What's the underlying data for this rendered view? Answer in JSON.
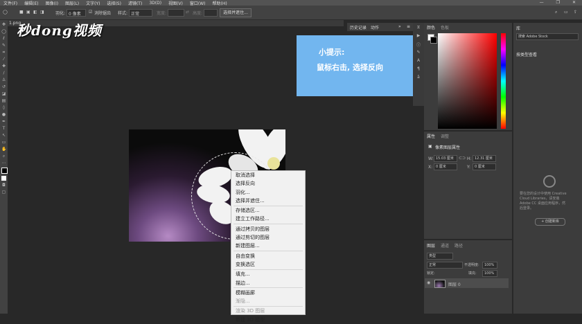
{
  "menubar": {
    "items": [
      "文件(F)",
      "编辑(E)",
      "图像(I)",
      "图层(L)",
      "文字(Y)",
      "选择(S)",
      "滤镜(T)",
      "3D(D)",
      "视图(V)",
      "窗口(W)",
      "帮助(H)"
    ],
    "window_controls": [
      "—",
      "❐",
      "✕"
    ]
  },
  "options": {
    "feather_label": "羽化:",
    "feather_value": "0 像素",
    "antialias_label": "消除锯齿",
    "style_label": "样式:",
    "style_value": "正常",
    "width_label": "宽度:",
    "height_label": "高度:",
    "select_mask_button": "选择并遮住..."
  },
  "document": {
    "tab_title": "1.png",
    "watermark": "秒dong视频"
  },
  "tip": {
    "title": "小提示:",
    "body": "鼠标右击, 选择反向"
  },
  "context_menu": {
    "items": [
      {
        "label": "取消选择",
        "disabled": false
      },
      {
        "label": "选择反向",
        "disabled": false
      },
      {
        "label": "羽化...",
        "disabled": false
      },
      {
        "label": "选择并遮住...",
        "disabled": false
      },
      {
        "sep": true
      },
      {
        "label": "存储选区...",
        "disabled": false
      },
      {
        "label": "建立工作路径...",
        "disabled": false
      },
      {
        "sep": true
      },
      {
        "label": "通过拷贝的图层",
        "disabled": false
      },
      {
        "label": "通过剪切的图层",
        "disabled": false
      },
      {
        "label": "新建图层...",
        "disabled": false
      },
      {
        "sep": true
      },
      {
        "label": "自由变换",
        "disabled": false
      },
      {
        "label": "变换选区",
        "disabled": false
      },
      {
        "sep": true
      },
      {
        "label": "填充...",
        "disabled": false
      },
      {
        "label": "描边...",
        "disabled": false
      },
      {
        "sep": true
      },
      {
        "label": "模糊画廊",
        "disabled": false
      },
      {
        "label": "渐隐...",
        "disabled": true
      },
      {
        "sep": true
      },
      {
        "label": "渲染 3D 图层",
        "disabled": true
      },
      {
        "label": "新建 3D 模型",
        "disabled": false
      }
    ]
  },
  "panels": {
    "history_tab": "历史记录",
    "actions_tab": "动作",
    "color_tab": "颜色",
    "swatches_tab": "色板",
    "properties_tab": "属性",
    "adjustments_tab": "调整",
    "doc_props": "像素图层属性",
    "w_label": "W:",
    "w_value": "15.03 厘米",
    "h_label": "H:",
    "h_value": "12.31 厘米",
    "x_label": "X:",
    "x_value": "0 厘米",
    "y_label": "Y:",
    "y_value": "0 厘米",
    "layers_tab": "图层",
    "channels_tab": "通道",
    "paths_tab": "路径",
    "kind_value": "类型",
    "blend_value": "正常",
    "opacity_label": "不透明度:",
    "opacity_value": "100%",
    "lock_label": "锁定:",
    "fill_label": "填充:",
    "fill_value": "100%",
    "layer_name": "图层 0",
    "libraries_tab": "库",
    "library_search": "搜索 Adobe Stock",
    "library_view": "按类型查看",
    "library_msg": "要在您的设计中使用 Creative Cloud Libraries，请安装 Adobe CC 桌面应用程序，然后登录。",
    "library_button": "+ 创建新库"
  },
  "colors": {
    "tip_bg": "#72b6ef",
    "ui_dark": "#282828",
    "panel": "#3c3c3c"
  }
}
